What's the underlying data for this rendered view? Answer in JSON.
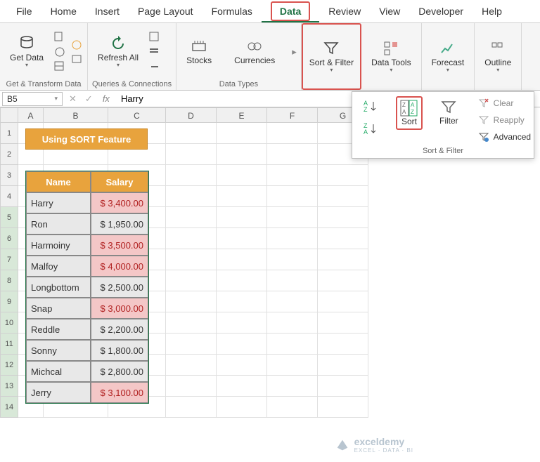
{
  "tabs": [
    "File",
    "Home",
    "Insert",
    "Page Layout",
    "Formulas",
    "Data",
    "Review",
    "View",
    "Developer",
    "Help"
  ],
  "active_tab": "Data",
  "ribbon": {
    "get_data": "Get\nData",
    "refresh": "Refresh\nAll",
    "stocks": "Stocks",
    "currencies": "Currencies",
    "sort_filter": "Sort &\nFilter",
    "data_tools": "Data\nTools",
    "forecast": "Forecast",
    "outline": "Outline",
    "grp1": "Get & Transform Data",
    "grp2": "Queries & Connections",
    "grp3": "Data Types"
  },
  "namebox": "B5",
  "formula": "Harry",
  "dropdown": {
    "sort_asc": "A→Z",
    "sort_desc": "Z→A",
    "sort": "Sort",
    "filter": "Filter",
    "clear": "Clear",
    "reapply": "Reapply",
    "advanced": "Advanced",
    "footer": "Sort & Filter"
  },
  "sheet": {
    "title": "Using SORT Feature",
    "headers": {
      "name": "Name",
      "salary": "Salary"
    },
    "rows": [
      {
        "name": "Harry",
        "salary": "$ 3,400.00",
        "hl": true
      },
      {
        "name": "Ron",
        "salary": "$ 1,950.00",
        "hl": false
      },
      {
        "name": "Harmoiny",
        "salary": "$ 3,500.00",
        "hl": true
      },
      {
        "name": "Malfoy",
        "salary": "$ 4,000.00",
        "hl": true
      },
      {
        "name": "Longbottom",
        "salary": "$ 2,500.00",
        "hl": false
      },
      {
        "name": "Snap",
        "salary": "$ 3,000.00",
        "hl": true
      },
      {
        "name": "Reddle",
        "salary": "$ 2,200.00",
        "hl": false
      },
      {
        "name": "Sonny",
        "salary": "$ 1,800.00",
        "hl": false
      },
      {
        "name": "Michcal",
        "salary": "$ 2,800.00",
        "hl": false
      },
      {
        "name": "Jerry",
        "salary": "$ 3,100.00",
        "hl": true
      }
    ]
  },
  "watermark": {
    "brand": "exceldemy",
    "tagline": "EXCEL · DATA · BI"
  },
  "fx": "fx"
}
